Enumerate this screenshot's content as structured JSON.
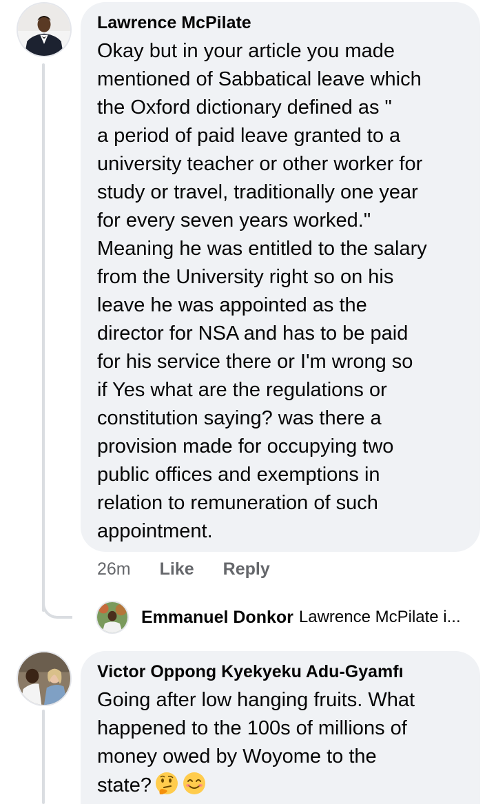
{
  "comments": [
    {
      "author": "Lawrence McPilate",
      "text": "Okay but in your article you made\nmentioned  of Sabbatical leave which\nthe Oxford dictionary defined as \"\na period of paid leave granted to a\nuniversity teacher or other worker for\nstudy or travel, traditionally one year\nfor every seven years worked.\"\nMeaning he was entitled to the salary\nfrom the University right so on his\nleave he was appointed as the\ndirector for NSA and has to be paid\nfor his service there or I'm wrong so\nif Yes what are the regulations or\nconstitution saying? was there a\nprovision made for occupying two\npublic offices and exemptions in\nrelation to remuneration of such\nappointment.",
      "time": "26m",
      "like_label": "Like",
      "reply_label": "Reply",
      "reply_preview": {
        "author": "Emmanuel Donkor",
        "snippet": "Lawrence McPilate i..."
      }
    },
    {
      "author": "Victor Oppong Kyekyeku Adu-Gyamfı",
      "text": "Going after low hanging fruits. What\nhappened to the 100s of millions of\nmoney owed by Woyome to the\nstate?",
      "emojis": [
        "thinking-face",
        "smiling-face"
      ]
    }
  ],
  "colors": {
    "bubble": "#f0f2f5",
    "meta": "#65676b",
    "thread_line": "#dadde1",
    "text": "#050505"
  }
}
